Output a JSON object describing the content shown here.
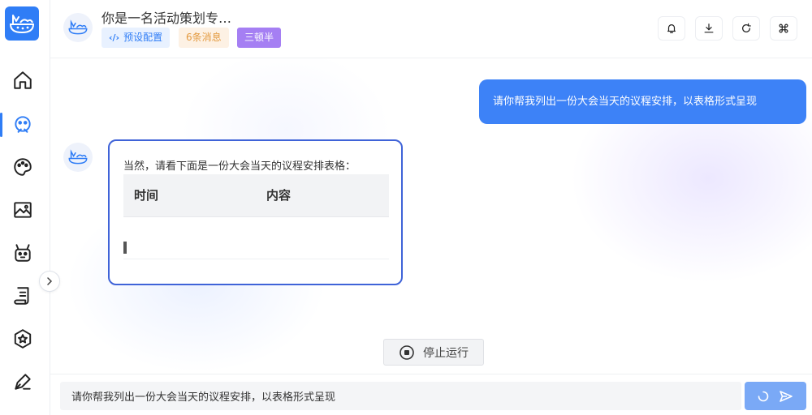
{
  "header": {
    "title": "你是一名活动策划专…",
    "tags": {
      "preset": "预设配置",
      "message_count": "6条消息",
      "model": "三顿半"
    }
  },
  "icons": {
    "logo": "logo-icon",
    "nav": [
      "home-icon",
      "chat-bot-icon",
      "palette-icon",
      "image-icon",
      "robot-icon",
      "document-icon",
      "star-badge-icon",
      "pen-icon"
    ],
    "header_actions": [
      "bell-icon",
      "download-icon",
      "refresh-icon",
      "command-icon"
    ]
  },
  "conversation": {
    "user_message": "请你帮我列出一份大会当天的议程安排，以表格形式呈现",
    "bot_message": {
      "intro": "当然，请看下面是一份大会当天的议程安排表格：",
      "table_headers": [
        "时间",
        "内容"
      ]
    }
  },
  "stop_button": {
    "label": "停止运行"
  },
  "input": {
    "value": "请你帮我列出一份大会当天的议程安排，以表格形式呈现"
  },
  "colors": {
    "accent": "#2f7df6",
    "user_bubble": "#3d82f7",
    "bot_border": "#3f63d8",
    "model_tag": "#a57ff3",
    "count_tag_text": "#e39a40",
    "send_button": "#7aa9f6"
  }
}
